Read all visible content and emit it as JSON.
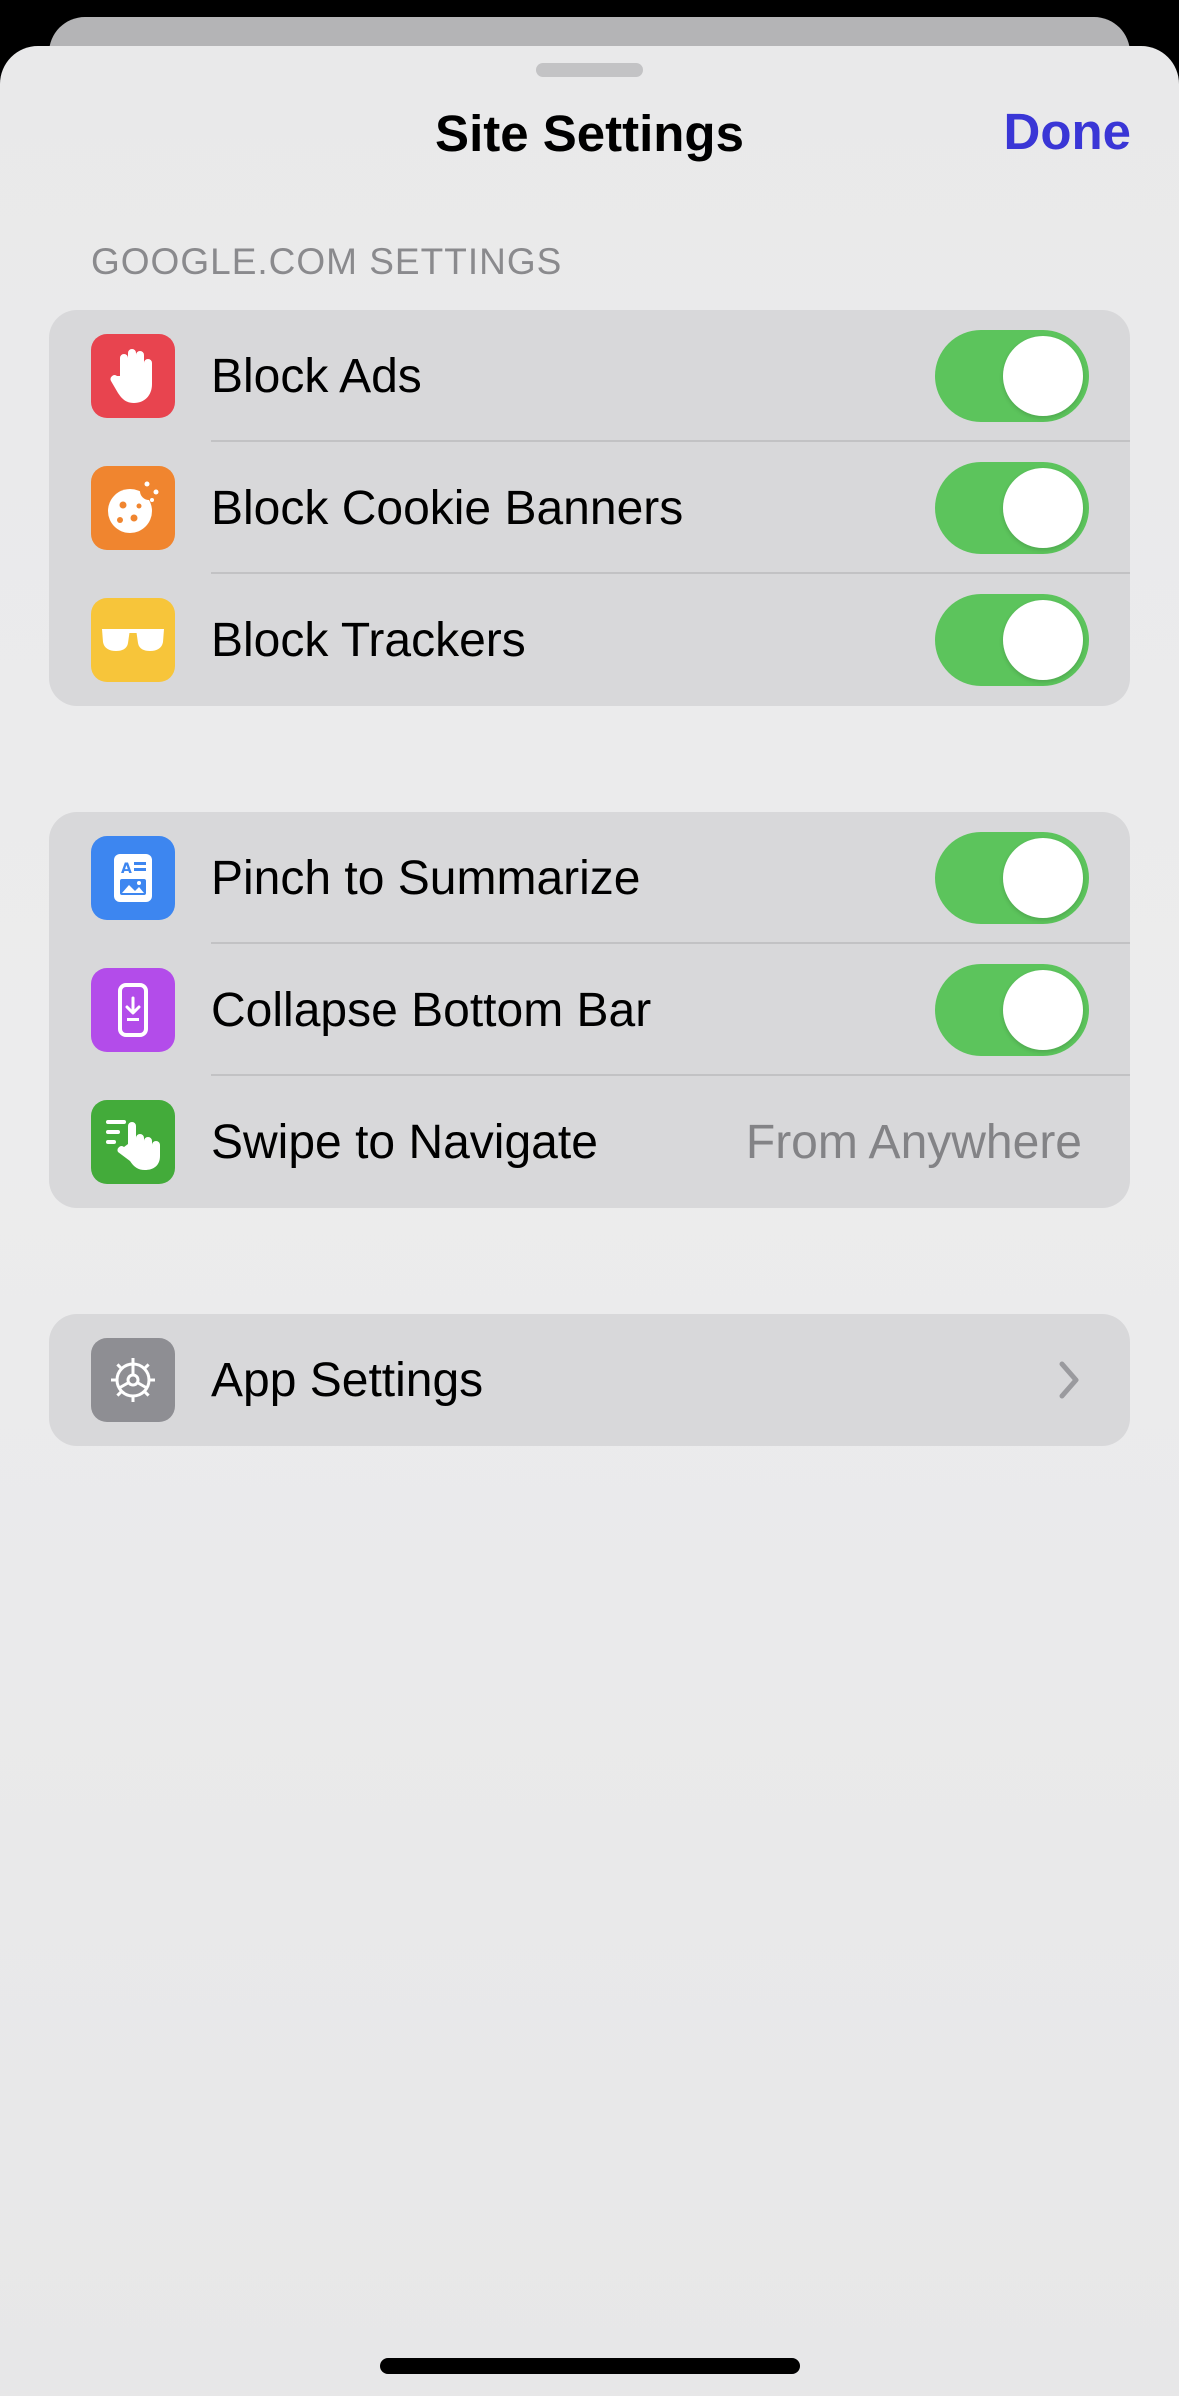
{
  "header": {
    "title": "Site Settings",
    "done_label": "Done"
  },
  "section_header": "GOOGLE.COM SETTINGS",
  "groups": [
    {
      "rows": [
        {
          "label": "Block Ads",
          "icon": "hand-stop-icon",
          "icon_color": "#e8444f",
          "toggle": true
        },
        {
          "label": "Block Cookie Banners",
          "icon": "cookie-icon",
          "icon_color": "#f0852f",
          "toggle": true
        },
        {
          "label": "Block Trackers",
          "icon": "sunglasses-icon",
          "icon_color": "#f7c53a",
          "toggle": true
        }
      ]
    },
    {
      "rows": [
        {
          "label": "Pinch to Summarize",
          "icon": "summary-doc-icon",
          "icon_color": "#3d86f0",
          "toggle": true
        },
        {
          "label": "Collapse Bottom Bar",
          "icon": "collapse-phone-icon",
          "icon_color": "#b34cea",
          "toggle": true
        },
        {
          "label": "Swipe to Navigate",
          "icon": "swipe-hand-icon",
          "icon_color": "#43ab3a",
          "value": "From Anywhere"
        }
      ]
    },
    {
      "rows": [
        {
          "label": "App Settings",
          "icon": "gear-icon",
          "icon_color": "#8e8e93",
          "chevron": true
        }
      ]
    }
  ],
  "colors": {
    "accent": "#3a36d6",
    "toggle_on": "#5cc45c"
  }
}
